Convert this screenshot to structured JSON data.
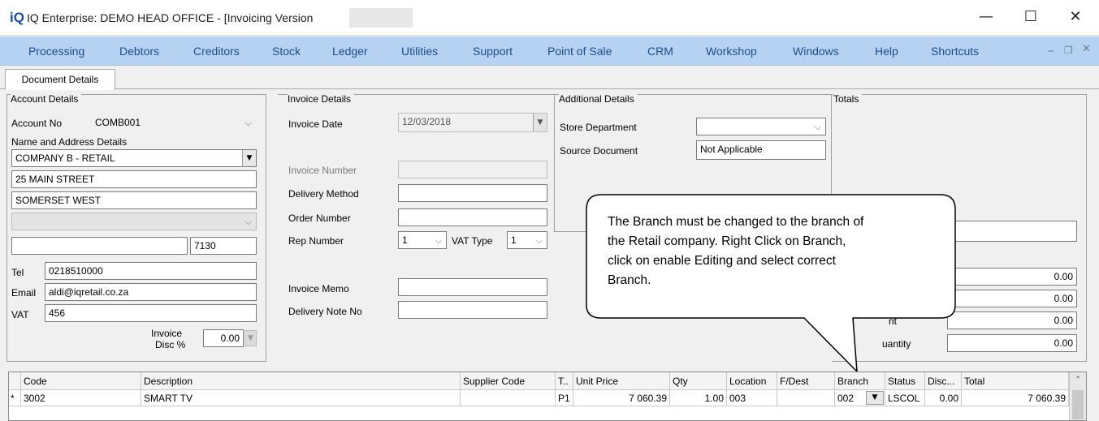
{
  "window": {
    "logo": "iQ",
    "title": "IQ Enterprise: DEMO HEAD OFFICE - [Invoicing Version",
    "minimize": "—",
    "maximize": "☐",
    "close": "✕"
  },
  "menu": [
    "Processing",
    "Debtors",
    "Creditors",
    "Stock",
    "Ledger",
    "Utilities",
    "Support",
    "Point of Sale",
    "CRM",
    "Workshop",
    "Windows",
    "Help",
    "Shortcuts"
  ],
  "menu_controls": {
    "minimize": "–",
    "restore": "❐",
    "close": "✕"
  },
  "tabs": [
    "Document Details"
  ],
  "account": {
    "group_label": "Account Details",
    "account_no_label": "Account No",
    "account_no": "COMB001",
    "name_address_label": "Name and Address Details",
    "name": "COMPANY B - RETAIL",
    "address1": "25 MAIN STREET",
    "address2": "SOMERSET WEST",
    "address3": "",
    "address4": "",
    "postal_code": "7130",
    "tel_label": "Tel",
    "tel": "0218510000",
    "email_label": "Email",
    "email": "aldi@iqretail.co.za",
    "vat_label": "VAT",
    "vat": "456",
    "invoice_disc_label_1": "Invoice",
    "invoice_disc_label_2": "Disc %",
    "invoice_disc": "0.00"
  },
  "invoice": {
    "group_label": "Invoice Details",
    "invoice_date_label": "Invoice Date",
    "invoice_date": "12/03/2018",
    "invoice_number_label": "Invoice Number",
    "invoice_number": "",
    "delivery_method_label": "Delivery Method",
    "delivery_method": "",
    "order_number_label": "Order Number",
    "order_number": "",
    "rep_number_label": "Rep Number",
    "rep_number": "1",
    "vat_type_label": "VAT Type",
    "vat_type": "1",
    "invoice_memo_label": "Invoice Memo",
    "invoice_memo": "",
    "delivery_note_label": "Delivery Note No",
    "delivery_note": ""
  },
  "additional": {
    "group_label": "Additional Details",
    "store_department_label": "Store Department",
    "store_department": "",
    "source_document_label": "Source Document",
    "source_document": "Not Applicable"
  },
  "totals": {
    "group_label": "Totals",
    "field_top": "",
    "values": [
      "0.00",
      "0.00",
      "0.00",
      "0.00"
    ],
    "label_partial_1": "nt",
    "label_partial_2": "uantity"
  },
  "callout": {
    "line1": "The Branch must be changed to the branch of",
    "line2": "the Retail company. Right Click on Branch,",
    "line3": "click on enable Editing and select correct",
    "line4": "Branch."
  },
  "grid": {
    "headers": [
      "Code",
      "Description",
      "Supplier Code",
      "T..",
      "Unit Price",
      "Qty",
      "Location",
      "F/Dest",
      "Branch",
      "Status",
      "Disc...",
      "Total"
    ],
    "rows": [
      {
        "marker": "*",
        "code": "3002",
        "description": "SMART TV",
        "supplier_code": "",
        "type": "P1",
        "unit_price": "7 060.39",
        "qty": "1.00",
        "location": "003",
        "fdest": "",
        "branch": "002",
        "status": "LSCOL",
        "disc": "0.00",
        "total": "7 060.39"
      }
    ]
  },
  "icons": {
    "dropdown": "chevron-down-icon",
    "combo": "dropdown-triangle-icon",
    "scroll_up": "chevron-up-icon"
  }
}
